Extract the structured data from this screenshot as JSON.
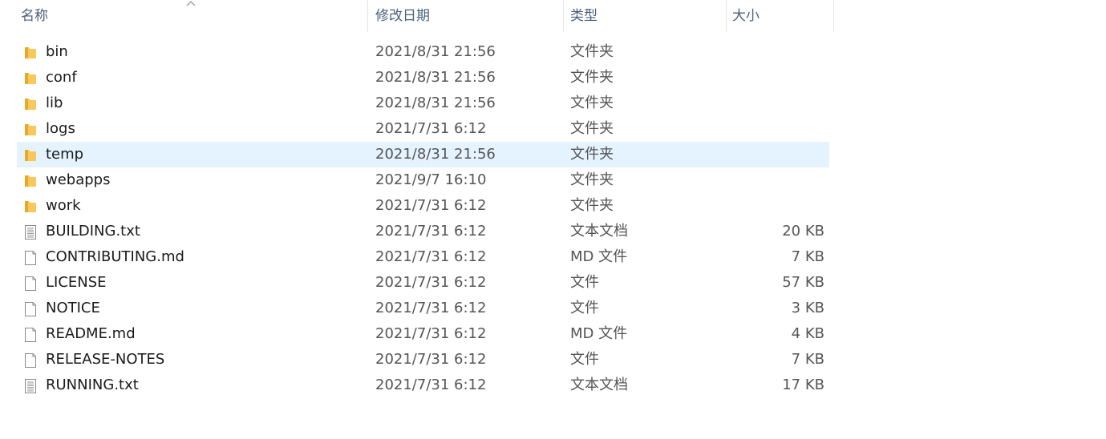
{
  "columns": {
    "name": "名称",
    "modified": "修改日期",
    "type": "类型",
    "size": "大小"
  },
  "selected_index": 4,
  "files": [
    {
      "name": "bin",
      "modified": "2021/8/31 21:56",
      "type": "文件夹",
      "size": "",
      "icon": "folder-icon"
    },
    {
      "name": "conf",
      "modified": "2021/8/31 21:56",
      "type": "文件夹",
      "size": "",
      "icon": "folder-icon"
    },
    {
      "name": "lib",
      "modified": "2021/8/31 21:56",
      "type": "文件夹",
      "size": "",
      "icon": "folder-icon"
    },
    {
      "name": "logs",
      "modified": "2021/7/31 6:12",
      "type": "文件夹",
      "size": "",
      "icon": "folder-icon"
    },
    {
      "name": "temp",
      "modified": "2021/8/31 21:56",
      "type": "文件夹",
      "size": "",
      "icon": "folder-icon"
    },
    {
      "name": "webapps",
      "modified": "2021/9/7 16:10",
      "type": "文件夹",
      "size": "",
      "icon": "folder-icon"
    },
    {
      "name": "work",
      "modified": "2021/7/31 6:12",
      "type": "文件夹",
      "size": "",
      "icon": "folder-icon"
    },
    {
      "name": "BUILDING.txt",
      "modified": "2021/7/31 6:12",
      "type": "文本文档",
      "size": "20 KB",
      "icon": "text-file-icon"
    },
    {
      "name": "CONTRIBUTING.md",
      "modified": "2021/7/31 6:12",
      "type": "MD 文件",
      "size": "7 KB",
      "icon": "file-icon"
    },
    {
      "name": "LICENSE",
      "modified": "2021/7/31 6:12",
      "type": "文件",
      "size": "57 KB",
      "icon": "file-icon"
    },
    {
      "name": "NOTICE",
      "modified": "2021/7/31 6:12",
      "type": "文件",
      "size": "3 KB",
      "icon": "file-icon"
    },
    {
      "name": "README.md",
      "modified": "2021/7/31 6:12",
      "type": "MD 文件",
      "size": "4 KB",
      "icon": "file-icon"
    },
    {
      "name": "RELEASE-NOTES",
      "modified": "2021/7/31 6:12",
      "type": "文件",
      "size": "7 KB",
      "icon": "file-icon"
    },
    {
      "name": "RUNNING.txt",
      "modified": "2021/7/31 6:12",
      "type": "文本文档",
      "size": "17 KB",
      "icon": "text-file-icon"
    }
  ],
  "colors": {
    "header_text": "#4c607a",
    "selected_row": "#e5f3ff",
    "folder": "#f8c85a",
    "folder_dark": "#e6a92a"
  }
}
